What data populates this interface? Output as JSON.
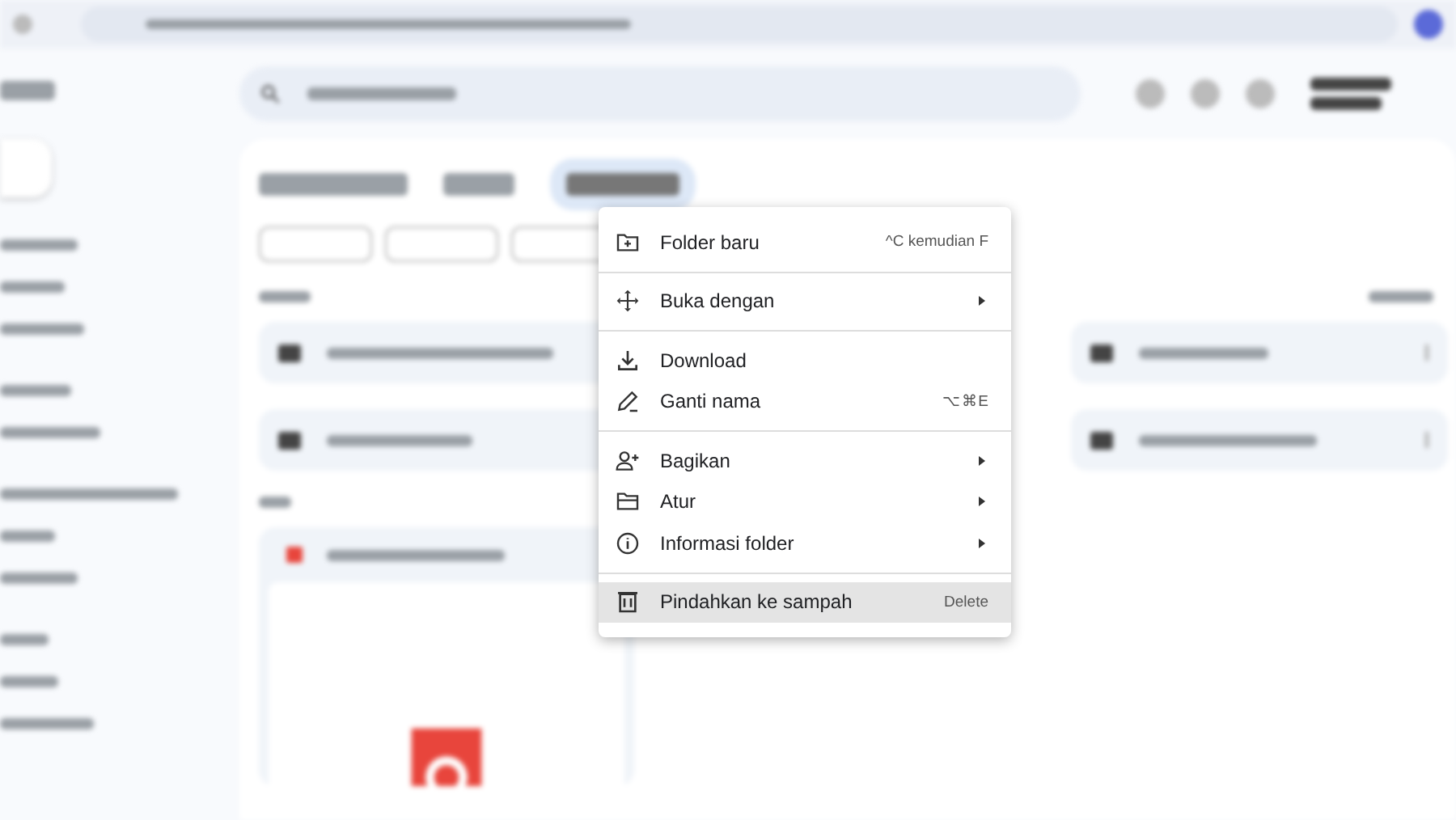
{
  "context_menu": {
    "sections": [
      [
        {
          "label": "Folder baru",
          "shortcut": "^C kemudian F",
          "submenu": false,
          "selected": false
        }
      ],
      [
        {
          "label": "Buka dengan",
          "submenu": true,
          "selected": false
        }
      ],
      [
        {
          "label": "Download",
          "submenu": false,
          "selected": false
        },
        {
          "label": "Ganti nama",
          "shortcut": "⌥⌘E",
          "submenu": false,
          "selected": false
        }
      ],
      [
        {
          "label": "Bagikan",
          "submenu": true,
          "selected": false
        },
        {
          "label": "Atur",
          "submenu": true,
          "selected": false
        },
        {
          "label": "Informasi folder",
          "submenu": true,
          "selected": false
        }
      ],
      [
        {
          "label": "Pindahkan ke sampah",
          "shortcut": "Delete",
          "submenu": false,
          "selected": true
        }
      ]
    ]
  }
}
